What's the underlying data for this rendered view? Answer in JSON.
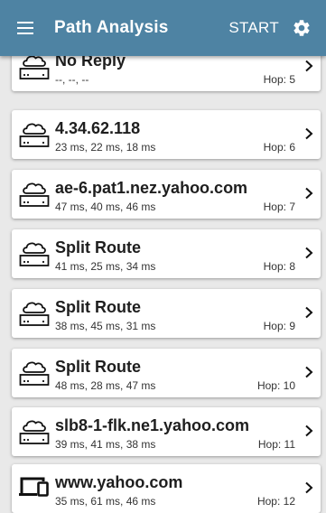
{
  "appbar": {
    "title": "Path Analysis",
    "start_label": "START",
    "menu_icon": "hamburger-menu-icon",
    "settings_icon": "gear-icon",
    "color": "#4e83a3"
  },
  "hops": [
    {
      "name": "No Reply",
      "times": "--, --, --",
      "hop_label": "Hop:  5",
      "icon": "cloud-router-icon"
    },
    {
      "name": "4.34.62.118",
      "times": "23 ms,  22 ms,  18 ms",
      "hop_label": "Hop:  6",
      "icon": "cloud-router-icon"
    },
    {
      "name": "ae-6.pat1.nez.yahoo.com",
      "times": "47 ms,  40 ms,  46 ms",
      "hop_label": "Hop:  7",
      "icon": "cloud-router-icon"
    },
    {
      "name": "Split Route",
      "times": "41 ms,  25 ms,  34 ms",
      "hop_label": "Hop:  8",
      "icon": "cloud-router-icon"
    },
    {
      "name": "Split Route",
      "times": "38 ms,  45 ms,  31 ms",
      "hop_label": "Hop:  9",
      "icon": "cloud-router-icon"
    },
    {
      "name": "Split Route",
      "times": "48 ms,  28 ms,  47 ms",
      "hop_label": "Hop:  10",
      "icon": "cloud-router-icon"
    },
    {
      "name": "slb8-1-flk.ne1.yahoo.com",
      "times": "39 ms,  41 ms,  38 ms",
      "hop_label": "Hop:  11",
      "icon": "cloud-router-icon"
    },
    {
      "name": "www.yahoo.com",
      "times": "35 ms,  61 ms,  46 ms",
      "hop_label": "Hop:  12",
      "icon": "computer-device-icon"
    }
  ]
}
